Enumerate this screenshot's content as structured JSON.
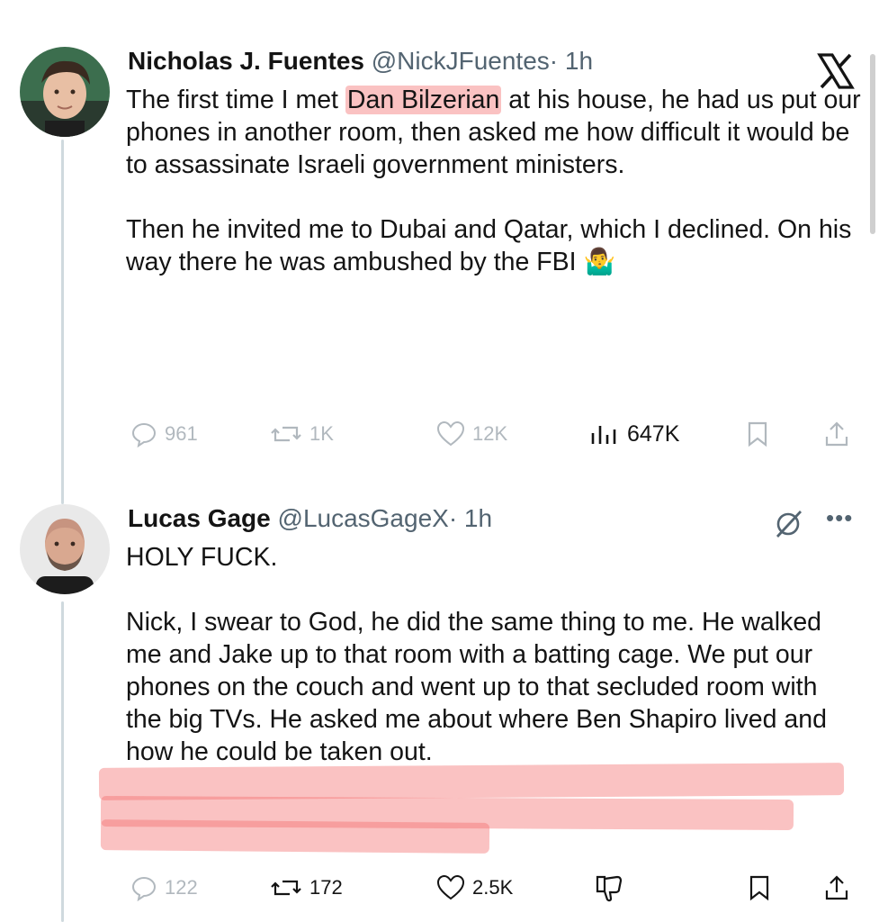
{
  "tweet1": {
    "name": "Nicholas J. Fuentes",
    "handle": "@NickJFuentes",
    "time": "· 1h",
    "text_before_highlight": "The first time I met ",
    "highlight": "Dan Bilzerian",
    "text_after_highlight": " at his house, he had us put our phones in another room, then asked me how difficult it would be to assassinate Israeli government ministers.",
    "paragraph2": "Then he invited me to Dubai and Qatar, which I declined. On his way there he was ambushed by the FBI",
    "emoji": "🤷‍♂️",
    "replies": "961",
    "reposts": "1K",
    "likes": "12K",
    "views": "647K"
  },
  "tweet2": {
    "name": "Lucas Gage",
    "handle": "@LucasGageX",
    "time": "· 1h",
    "paragraph1": "HOLY FUCK.",
    "paragraph2": "Nick, I swear to God, he did the same thing to me. He walked me and Jake up to that room with a batting cage. We put our phones on the couch and went up to that secluded room with the big TVs. He asked me about where Ben Shapiro lived and how he could be taken out.",
    "replies": "122",
    "reposts": "172",
    "likes": "2.5K"
  },
  "icons": {
    "platform": "x-logo-icon",
    "reply": "reply-icon",
    "repost": "repost-icon",
    "like": "heart-icon",
    "views": "views-icon",
    "bookmark": "bookmark-icon",
    "share": "share-icon",
    "grok": "grok-icon",
    "more": "more-icon",
    "dislike": "dislike-icon"
  },
  "colors": {
    "highlight": "#f47878",
    "secondary_text": "#536471",
    "thread_line": "#cfd9de"
  }
}
